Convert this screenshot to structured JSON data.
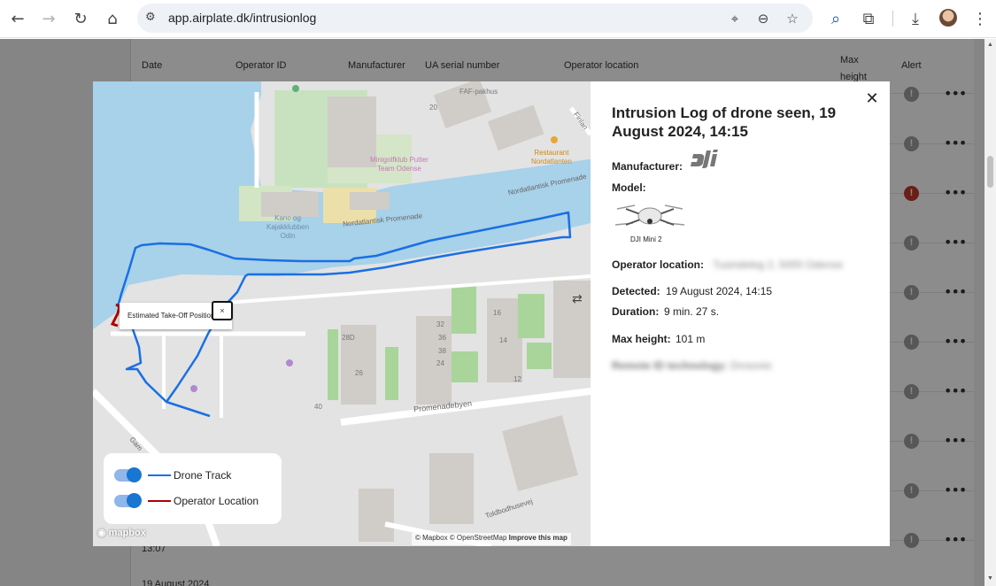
{
  "browser": {
    "url": "app.airplate.dk/intrusionlog"
  },
  "table": {
    "headers": [
      "Date",
      "Operator ID",
      "Manufacturer",
      "UA serial number",
      "Operator location",
      "Max height",
      "Alert"
    ],
    "bottom_rows": [
      "13:07",
      "19 August 2024"
    ]
  },
  "map": {
    "labels": {
      "faf": "FAF-pakhus",
      "restaurant": "Restaurant\nNordatlanten",
      "minigolf": "Minigolfklub Putter\nTeam Odense",
      "kano": "Kano og\nKajakklubben\nOdin",
      "promenade_1": "Nordatlantisk Promenade",
      "promenade_2": "Nordatlantisk Promenade",
      "promenadebyen": "Promenadebyen",
      "toldbod": "Toldbodhusevej",
      "finland": "Finlan",
      "gam": "Gam",
      "n20": "20",
      "n40": "40",
      "n26": "26",
      "n24": "24",
      "n12": "12",
      "n38": "38",
      "n36": "36",
      "n32": "32",
      "n280": "28D",
      "n14": "14",
      "n16": "16"
    },
    "popup_text": "Estimated Take-Off Position",
    "legend": {
      "drone_track": "Drone Track",
      "operator_location": "Operator Location"
    },
    "mapbox": "mapbox",
    "attribution_1": "© Mapbox © OpenStreetMap",
    "attribution_2": "Improve this map",
    "colors": {
      "track": "#1a6fe3",
      "operator": "#b00000",
      "water": "#a8d1ea"
    }
  },
  "info": {
    "title": "Intrusion Log of drone seen, 19 August 2024, 14:15",
    "manufacturer_label": "Manufacturer:",
    "model_label": "Model:",
    "model_name": "DJI Mini 2",
    "operator_location_label": "Operator location:",
    "operator_location_value": "Tusindeleg 2, 5000 Odense",
    "detected_label": "Detected:",
    "detected_value": "19 August 2024, 14:15",
    "duration_label": "Duration:",
    "duration_value": "9 min. 27 s.",
    "max_height_label": "Max height:",
    "max_height_value": "101 m",
    "remote_id_label": "Remote ID technology:",
    "remote_id_value": "Drosonic"
  }
}
